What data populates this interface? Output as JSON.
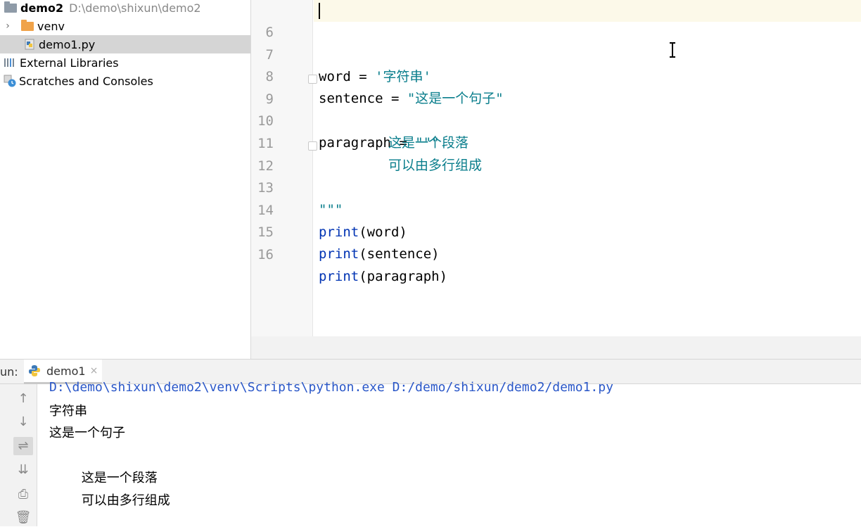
{
  "project_tree": {
    "root_name": "demo2",
    "root_path": "D:\\demo\\shixun\\demo2",
    "venv": "venv",
    "file": "demo1.py",
    "external_libraries": "External Libraries",
    "scratches": "Scratches and Consoles"
  },
  "editor": {
    "lines": [
      {
        "num": "6",
        "text": ""
      },
      {
        "num": "7",
        "text": "word = '字符串'"
      },
      {
        "num": "8",
        "text": "sentence = \"这是一个句子\""
      },
      {
        "num": "9",
        "text": "paragraph = \"\"\""
      },
      {
        "num": "10",
        "text": "        这是一个段落"
      },
      {
        "num": "11",
        "text": "        可以由多行组成"
      },
      {
        "num": "12",
        "text": "\"\"\""
      },
      {
        "num": "13",
        "text": ""
      },
      {
        "num": "14",
        "text": "print(word)"
      },
      {
        "num": "15",
        "text": "print(sentence)"
      },
      {
        "num": "16",
        "text": "print(paragraph)"
      }
    ],
    "tokens": {
      "word_var": "word",
      "word_str": "'字符串'",
      "sentence_var": "sentence",
      "sentence_str": "\"这是一个句子\"",
      "paragraph_var": "paragraph",
      "triple_quote": "\"\"\"",
      "para_line1": "这是一个段落",
      "para_line2": "可以由多行组成",
      "eq": " = ",
      "print_kw": "print",
      "arg_word": "(word)",
      "arg_sentence": "(sentence)",
      "arg_paragraph": "(paragraph)"
    }
  },
  "run_panel": {
    "label": "un:",
    "tab": "demo1",
    "tab_close": "×",
    "command": "D:\\demo\\shixun\\demo2\\venv\\Scripts\\python.exe D:/demo/shixun/demo2/demo1.py",
    "output": [
      "字符串",
      "这是一个句子",
      "",
      "        这是一个段落",
      "        可以由多行组成"
    ]
  },
  "icons": {
    "chevron": "›",
    "up": "↑",
    "down": "↓",
    "soft_wrap": "⇌",
    "scroll_end": "⇊",
    "print": "⎙",
    "trash": "🗑"
  }
}
